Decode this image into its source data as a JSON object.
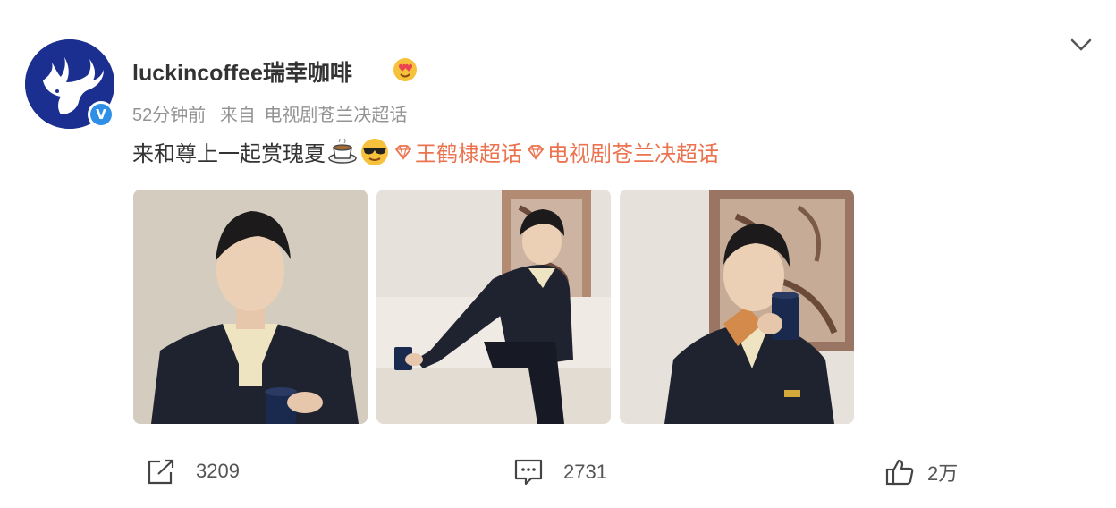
{
  "post": {
    "username": "luckincoffee瑞幸咖啡",
    "time": "52分钟前",
    "source_prefix": "来自",
    "source": "电视剧苍兰决超话",
    "text": "来和尊上一起赏瑰夏",
    "topic1": "王鹤棣超话",
    "topic2": "电视剧苍兰决超话"
  },
  "actions": {
    "share_count": "3209",
    "comment_count": "2731",
    "like_count": "2万"
  },
  "icons": {
    "avatar": "luckin-deer-logo",
    "verified": "verified-icon",
    "vip": "heart-eyes-badge-icon",
    "more": "chevron-down-icon",
    "share": "share-icon",
    "comment": "comment-icon",
    "like": "thumbs-up-icon",
    "topic": "topic-diamond-icon",
    "emoji1": "coffee-cup-emoji",
    "emoji2": "sunglasses-emoji"
  },
  "colors": {
    "topic": "#eb7350",
    "brand": "#1a2f8f",
    "meta": "#939393",
    "verified": "#2f8fe6"
  },
  "media": {
    "photos": [
      "photo-1",
      "photo-2",
      "photo-3"
    ]
  },
  "verified_mark": "V"
}
